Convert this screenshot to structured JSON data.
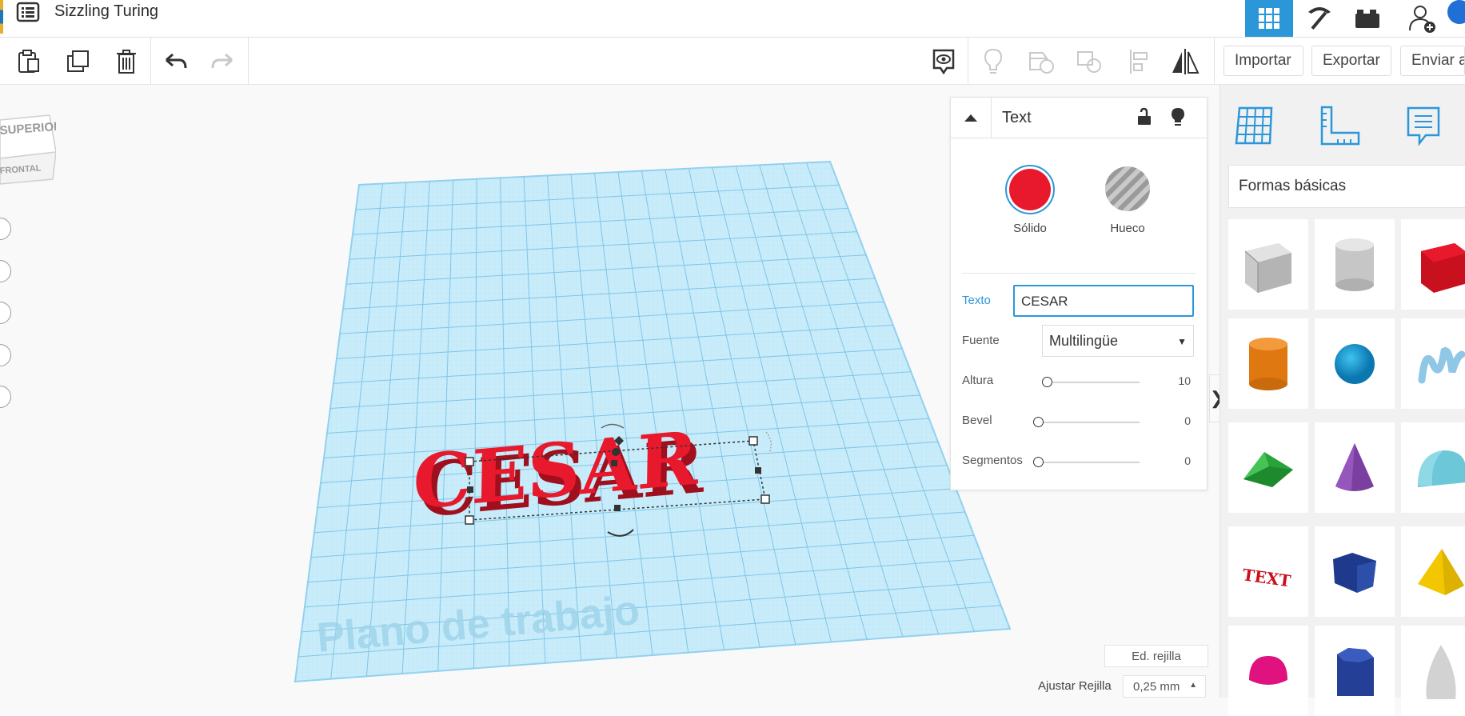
{
  "app": {
    "title": "Sizzling Turing"
  },
  "toolbar": {
    "import_label": "Importar",
    "export_label": "Exportar",
    "send_label": "Enviar a"
  },
  "viewcube": {
    "top_label": "SUPERIOR",
    "front_label": "FRONTAL"
  },
  "workplane": {
    "watermark": "Plano de trabajo",
    "object_text": "CESAR"
  },
  "inspector": {
    "title": "Text",
    "solid_label": "Sólido",
    "hole_label": "Hueco",
    "solid_color": "#e8192c",
    "text_label": "Texto",
    "text_value": "CESAR",
    "font_label": "Fuente",
    "font_value": "Multilingüe",
    "height_label": "Altura",
    "height_value": "10",
    "bevel_label": "Bevel",
    "bevel_value": "0",
    "segments_label": "Segmentos",
    "segments_value": "0"
  },
  "library": {
    "category": "Formas básicas",
    "shapes": [
      "box",
      "cylinder-hole",
      "box-red",
      "cylinder",
      "sphere",
      "scribble",
      "roof",
      "cone",
      "round-roof",
      "text",
      "polygon",
      "pyramid",
      "half-sphere",
      "prism",
      "paraboloid"
    ]
  },
  "grid": {
    "edit_label": "Ed. rejilla",
    "snap_label": "Ajustar Rejilla",
    "snap_value": "0,25 mm"
  },
  "colors": {
    "accent": "#2b97d9",
    "grid": "#a9dcf2",
    "object": "#e8192c"
  }
}
